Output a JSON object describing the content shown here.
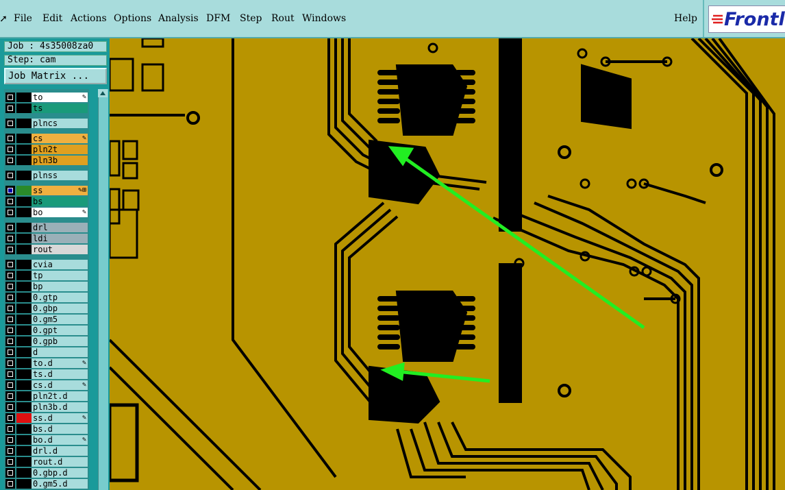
{
  "menubar": {
    "items": [
      {
        "label": "File",
        "u": "F"
      },
      {
        "label": "Edit",
        "u": "E"
      },
      {
        "label": "Actions",
        "u": "A"
      },
      {
        "label": "Options",
        "u": "O"
      },
      {
        "label": "Analysis",
        "u": ""
      },
      {
        "label": "DFM",
        "u": ""
      },
      {
        "label": "Step",
        "u": "S"
      },
      {
        "label": "Rout",
        "u": "R"
      },
      {
        "label": "Windows",
        "u": "W"
      },
      {
        "label": "Help",
        "u": ""
      }
    ],
    "logo_text": "Frontl"
  },
  "panel": {
    "job": "Job : 4s35008za0",
    "step": "Step: cam",
    "matrix_button": "Job Matrix ..."
  },
  "layers": [
    {
      "name": "to",
      "bg": "#ffffff",
      "mark": "✎",
      "col": "#000"
    },
    {
      "name": "ts",
      "bg": "#1a9a7a",
      "mark": "",
      "col": "#000"
    },
    {
      "name": "plncs",
      "bg": "#a8dcdc",
      "mark": "",
      "col": "#000",
      "gap": true
    },
    {
      "name": "cs",
      "bg": "#f0b040",
      "mark": "✎",
      "col": "#000",
      "gap": true
    },
    {
      "name": "pln2t",
      "bg": "#e0a020",
      "mark": "",
      "col": "#000"
    },
    {
      "name": "pln3b",
      "bg": "#e0a020",
      "mark": "",
      "col": "#000"
    },
    {
      "name": "plnss",
      "bg": "#a8dcdc",
      "mark": "",
      "col": "#000",
      "gap": true
    },
    {
      "name": "ss",
      "bg": "#f0b040",
      "mark": "✎⊞",
      "col": "#2a8a2a",
      "sel": true,
      "gap": true
    },
    {
      "name": "bs",
      "bg": "#1a9a7a",
      "mark": "",
      "col": "#000"
    },
    {
      "name": "bo",
      "bg": "#ffffff",
      "mark": "✎",
      "col": "#000"
    },
    {
      "name": "drl",
      "bg": "#9ab0b8",
      "mark": "",
      "col": "#000",
      "gap": true
    },
    {
      "name": "ldi",
      "bg": "#9ab0b8",
      "mark": "",
      "col": "#000"
    },
    {
      "name": "rout",
      "bg": "#d8d8d8",
      "mark": "",
      "col": "#000"
    },
    {
      "name": "cvia",
      "bg": "#a8dcdc",
      "mark": "",
      "col": "#000",
      "gap": true
    },
    {
      "name": "tp",
      "bg": "#a8dcdc",
      "mark": "",
      "col": "#000"
    },
    {
      "name": "bp",
      "bg": "#a8dcdc",
      "mark": "",
      "col": "#000"
    },
    {
      "name": "0.gtp",
      "bg": "#a8dcdc",
      "mark": "",
      "col": "#000"
    },
    {
      "name": "0.gbp",
      "bg": "#a8dcdc",
      "mark": "",
      "col": "#000"
    },
    {
      "name": "0.gm5",
      "bg": "#a8dcdc",
      "mark": "",
      "col": "#000"
    },
    {
      "name": "0.gpt",
      "bg": "#a8dcdc",
      "mark": "",
      "col": "#000"
    },
    {
      "name": "0.gpb",
      "bg": "#a8dcdc",
      "mark": "",
      "col": "#000"
    },
    {
      "name": "d",
      "bg": "#a8dcdc",
      "mark": "",
      "col": "#000"
    },
    {
      "name": "to.d",
      "bg": "#a8dcdc",
      "mark": "✎",
      "col": "#000"
    },
    {
      "name": "ts.d",
      "bg": "#a8dcdc",
      "mark": "",
      "col": "#000"
    },
    {
      "name": "cs.d",
      "bg": "#a8dcdc",
      "mark": "✎",
      "col": "#000"
    },
    {
      "name": "pln2t.d",
      "bg": "#a8dcdc",
      "mark": "",
      "col": "#000"
    },
    {
      "name": "pln3b.d",
      "bg": "#a8dcdc",
      "mark": "",
      "col": "#000"
    },
    {
      "name": "ss.d",
      "bg": "#a8dcdc",
      "mark": "✎",
      "col": "#e01010"
    },
    {
      "name": "bs.d",
      "bg": "#a8dcdc",
      "mark": "",
      "col": "#000"
    },
    {
      "name": "bo.d",
      "bg": "#a8dcdc",
      "mark": "✎",
      "col": "#000"
    },
    {
      "name": "drl.d",
      "bg": "#a8dcdc",
      "mark": "",
      "col": "#000"
    },
    {
      "name": "rout.d",
      "bg": "#a8dcdc",
      "mark": "",
      "col": "#000"
    },
    {
      "name": "0.gbp.d",
      "bg": "#a8dcdc",
      "mark": "",
      "col": "#000"
    },
    {
      "name": "0.gm5.d",
      "bg": "#a8dcdc",
      "mark": "",
      "col": "#000"
    }
  ],
  "colors": {
    "board": "#b89400",
    "trace": "#000000",
    "arrow": "#22ee22"
  }
}
